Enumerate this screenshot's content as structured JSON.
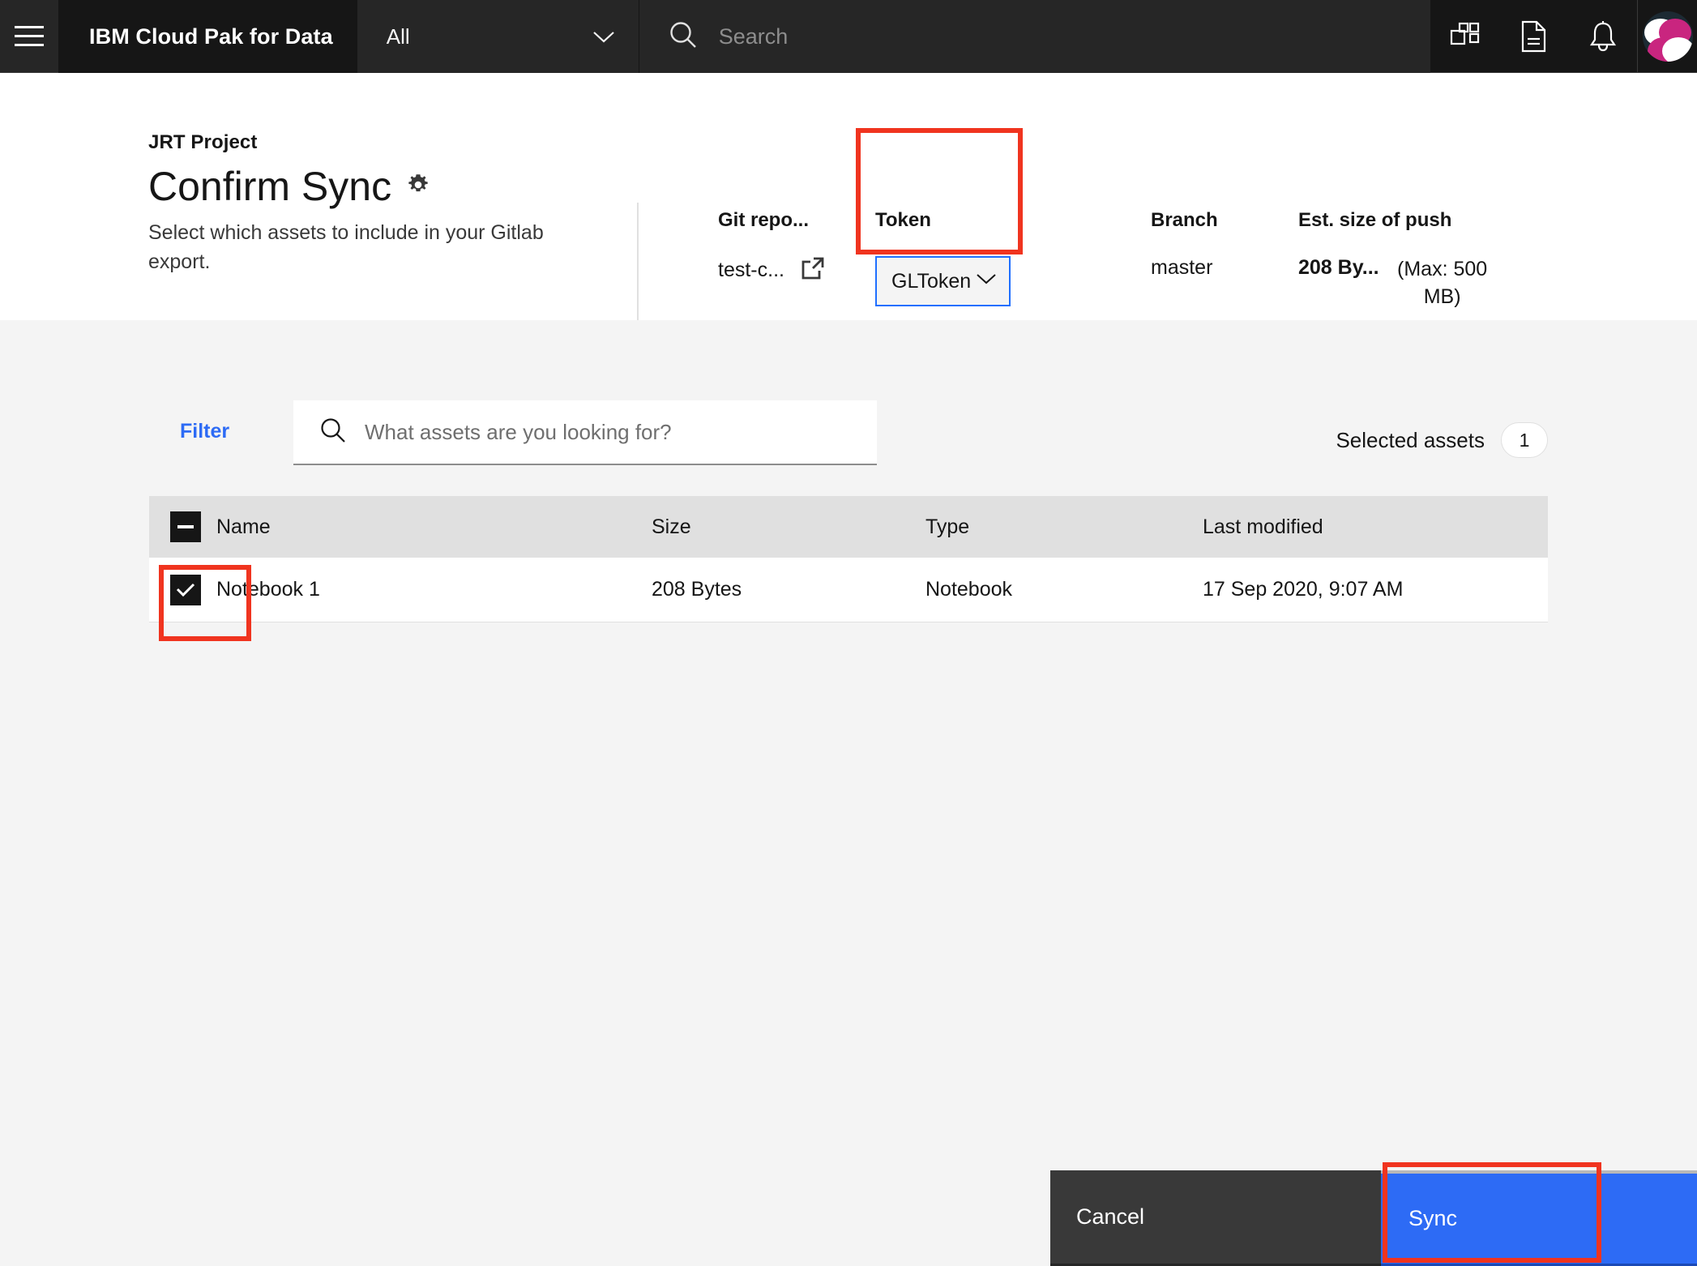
{
  "header": {
    "menu_icon": "hamburger-menu-icon",
    "brand": "IBM Cloud Pak for Data",
    "scope_selector": "All",
    "scope_chevron": "chevron-down-icon",
    "search_placeholder": "Search",
    "search_icon": "search-icon",
    "actions": [
      {
        "name": "app-switcher-icon",
        "label": "App switcher"
      },
      {
        "name": "document-icon",
        "label": "Documents"
      },
      {
        "name": "notifications-bell-icon",
        "label": "Notifications"
      }
    ],
    "avatar": "user-avatar"
  },
  "summary": {
    "project_name": "JRT Project",
    "title": "Confirm Sync",
    "settings_icon": "gear-icon",
    "subtitle": "Select which assets to include in your Gitlab export.",
    "meta": {
      "repo_label": "Git repo...",
      "repo_value": "test-c...",
      "repo_link_icon": "external-link-icon",
      "token_label": "Token",
      "token_value": "GLToken",
      "token_chevron": "chevron-down-icon",
      "branch_label": "Branch",
      "branch_value": "master",
      "size_label": "Est. size of push",
      "size_value": "208 By...",
      "size_max": "(Max: 500 MB)"
    }
  },
  "toolbar": {
    "filter_label": "Filter",
    "search_placeholder": "What assets are you looking for?",
    "search_value": "",
    "search_icon": "search-icon",
    "selected_label": "Selected assets",
    "selected_count": "1"
  },
  "table": {
    "select_all_state": "indeterminate",
    "columns": [
      "Name",
      "Size",
      "Type",
      "Last modified"
    ],
    "rows": [
      {
        "checked": true,
        "name": "Notebook 1",
        "size": "208 Bytes",
        "type": "Notebook",
        "last_modified": "17 Sep 2020, 9:07 AM"
      }
    ]
  },
  "footer": {
    "cancel_label": "Cancel",
    "sync_label": "Sync"
  },
  "annotations": {
    "colors": {
      "highlight": "#f0341f",
      "accent_blue": "#2d6bf5",
      "focus_blue": "#1f6fff",
      "header_dark": "#161616",
      "brand_magenta": "#c9257f"
    }
  }
}
